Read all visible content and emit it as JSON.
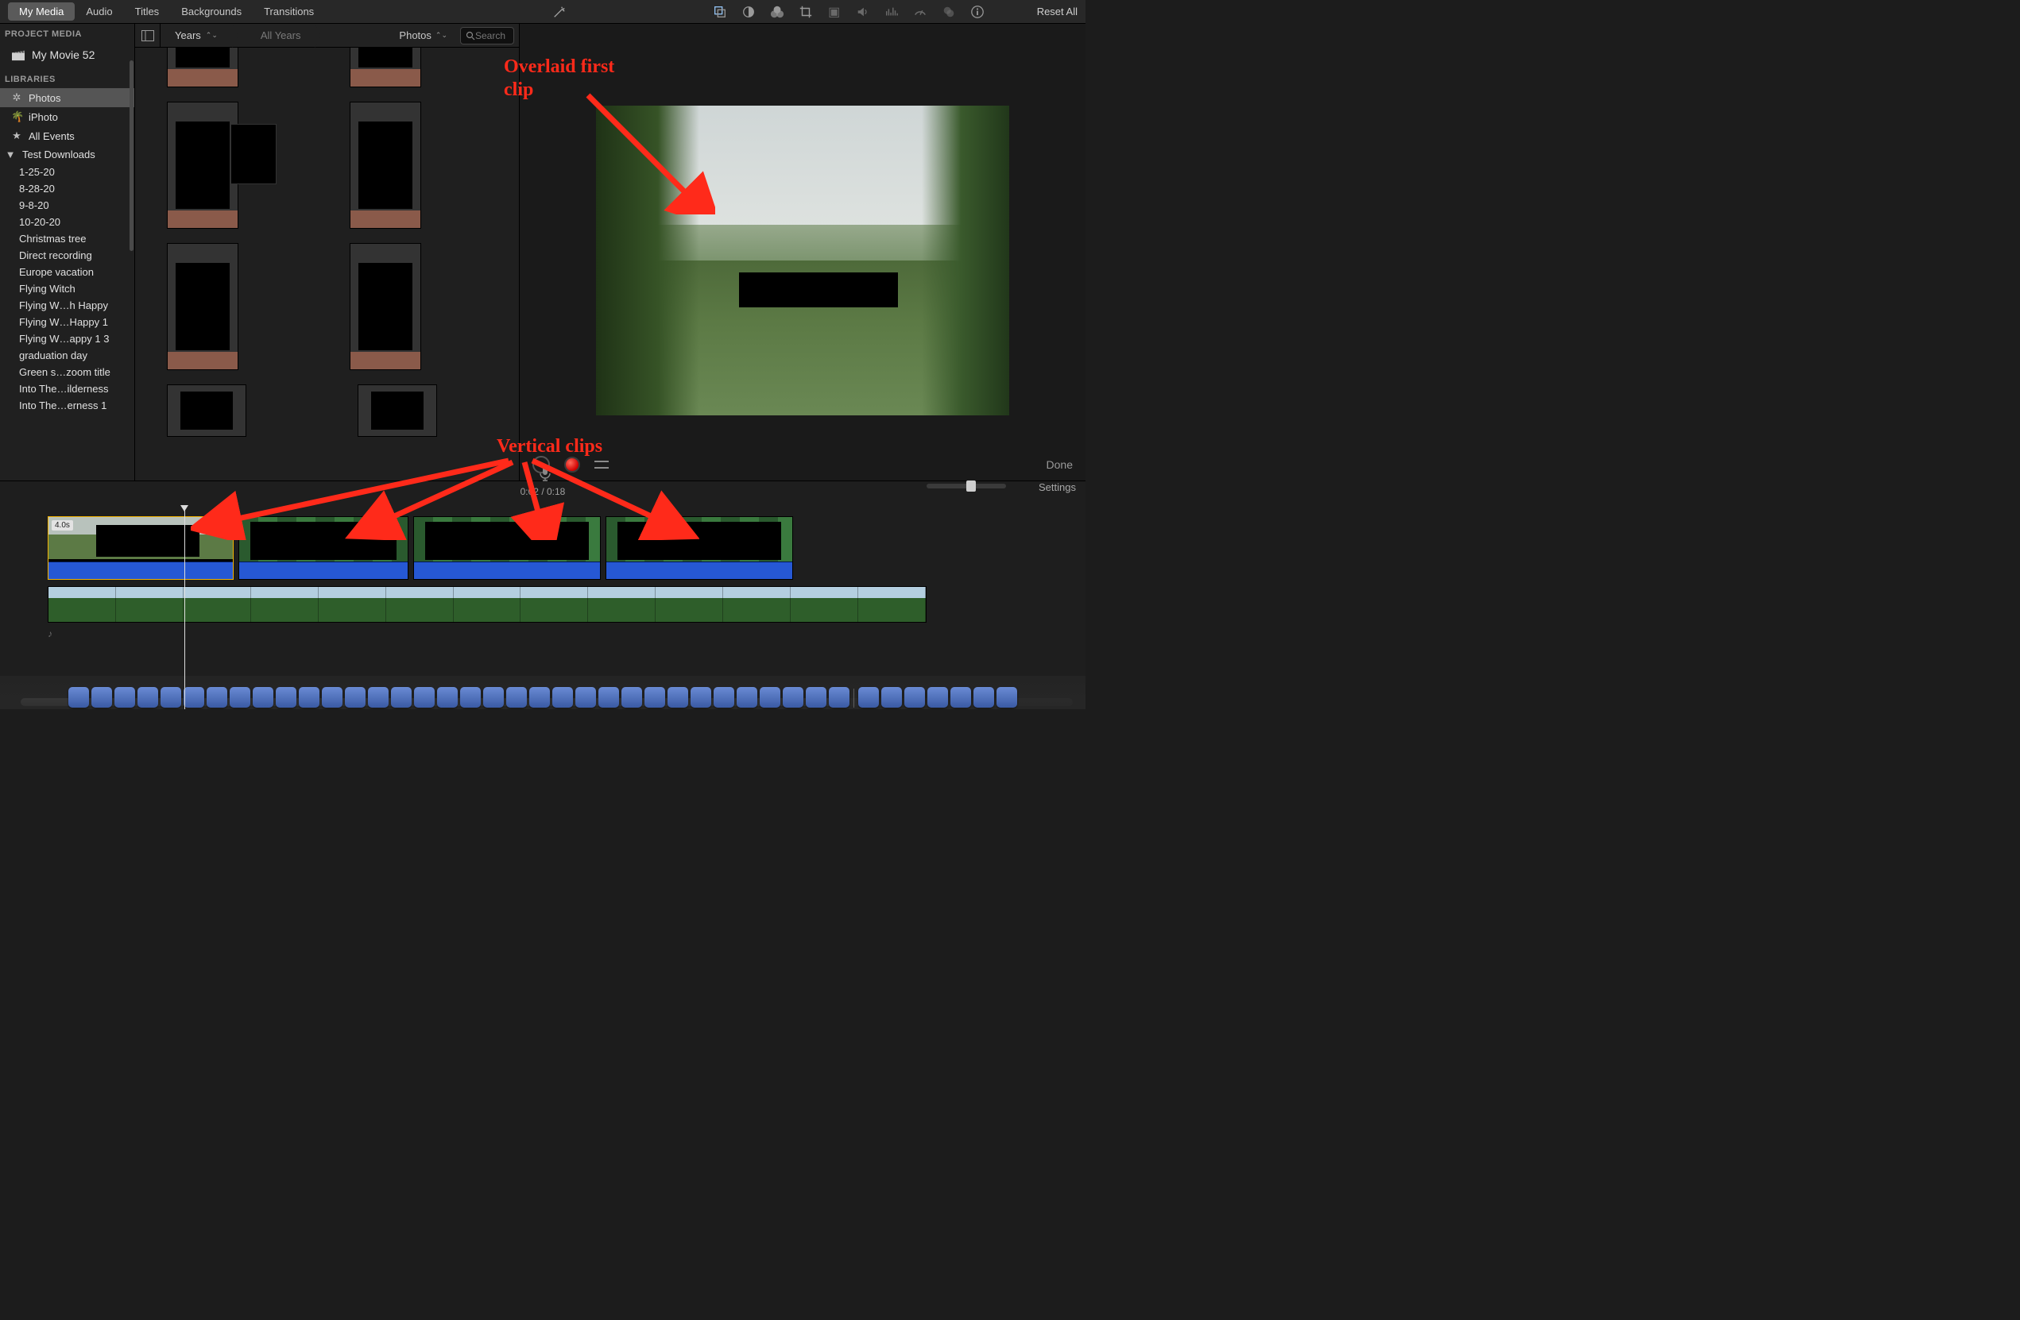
{
  "nav": {
    "my_media": "My Media",
    "audio": "Audio",
    "titles": "Titles",
    "backgrounds": "Backgrounds",
    "transitions": "Transitions"
  },
  "reset": "Reset All",
  "sidebar": {
    "project_media_header": "PROJECT MEDIA",
    "project_name": "My Movie 52",
    "libraries_header": "LIBRARIES",
    "photos": "Photos",
    "iphoto": "iPhoto",
    "all_events": "All Events",
    "test_downloads": "Test Downloads",
    "events": [
      "1-25-20",
      "8-28-20",
      "9-8-20",
      "10-20-20",
      "Christmas tree",
      "Direct recording",
      "Europe vacation",
      "Flying Witch",
      "Flying W…h Happy",
      "Flying W…Happy 1",
      "Flying W…appy 1  3",
      "graduation day",
      "Green s…zoom title",
      "Into The…ilderness",
      "Into The…erness 1"
    ]
  },
  "browser": {
    "crumb_years": "Years",
    "crumb_all_years": "All Years",
    "crumb_photos": "Photos",
    "search_placeholder": "Search"
  },
  "viewer": {
    "done": "Done"
  },
  "timeline": {
    "time_current": "0:02",
    "time_sep": " / ",
    "time_total": "0:18",
    "settings": "Settings",
    "clip_badge": "4.0s"
  },
  "annotations": {
    "overlaid": "Overlaid first\nclip",
    "vertical": "Vertical clips"
  },
  "colors": {
    "annotation": "#ff2a1a",
    "selection": "#f5b400",
    "audio_track": "#2658d4"
  }
}
